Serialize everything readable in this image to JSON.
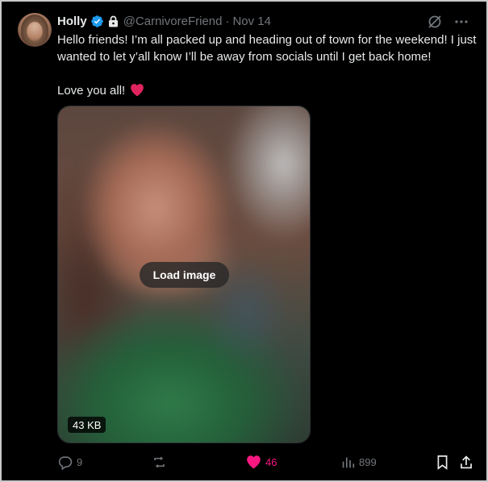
{
  "tweet": {
    "author_name": "Holly",
    "handle": "@CarnivoreFriend",
    "separator": "·",
    "date": "Nov 14",
    "text_paragraph_1": "Hello friends! I’m all packed up and heading out of town for the weekend! I just wanted to let y’all know I’ll be away from socials until I get back home!",
    "text_paragraph_2": "Love you all!",
    "inline_icon": "red-heart-emoji"
  },
  "media": {
    "load_label": "Load image",
    "size_label": "43 KB"
  },
  "actions": {
    "replies": "9",
    "reposts": "",
    "likes": "46",
    "views": "899"
  },
  "icons": {
    "verified": "verified-badge-icon",
    "protected": "lock-icon",
    "grok": "grok-icon",
    "more": "more-dots-icon",
    "reply": "reply-icon",
    "repost": "repost-icon",
    "like": "heart-filled-icon",
    "views": "views-chart-icon",
    "bookmark": "bookmark-icon",
    "share": "share-icon"
  },
  "colors": {
    "background": "#000000",
    "text": "#e7e9ea",
    "muted": "#71767b",
    "verified_blue": "#1d9bf0",
    "like_pink": "#f91880"
  }
}
